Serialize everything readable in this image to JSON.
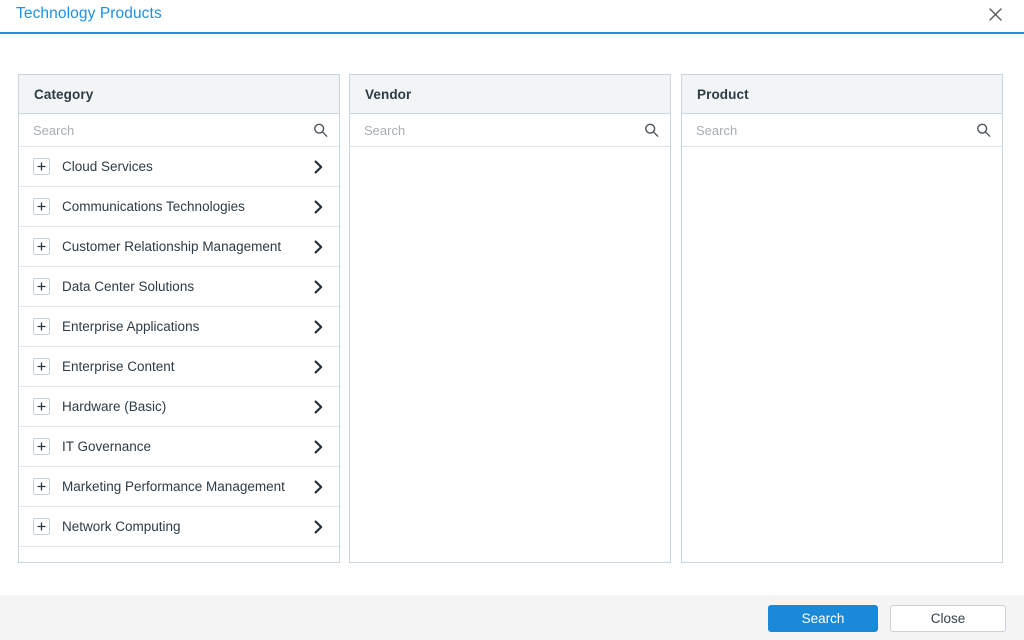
{
  "header": {
    "title": "Technology Products",
    "close_icon": "close-x-icon"
  },
  "panels": [
    {
      "key": "category",
      "title": "Category",
      "search_placeholder": "Search",
      "search_value": "",
      "search_icon": "magnifier-icon",
      "items": [
        {
          "expand_icon": "plus-icon",
          "label": "Cloud Services",
          "chevron_icon": "chevron-right-icon"
        },
        {
          "expand_icon": "plus-icon",
          "label": "Communications Technologies",
          "chevron_icon": "chevron-right-icon"
        },
        {
          "expand_icon": "plus-icon",
          "label": "Customer Relationship Management",
          "chevron_icon": "chevron-right-icon"
        },
        {
          "expand_icon": "plus-icon",
          "label": "Data Center Solutions",
          "chevron_icon": "chevron-right-icon"
        },
        {
          "expand_icon": "plus-icon",
          "label": "Enterprise Applications",
          "chevron_icon": "chevron-right-icon"
        },
        {
          "expand_icon": "plus-icon",
          "label": "Enterprise Content",
          "chevron_icon": "chevron-right-icon"
        },
        {
          "expand_icon": "plus-icon",
          "label": "Hardware (Basic)",
          "chevron_icon": "chevron-right-icon"
        },
        {
          "expand_icon": "plus-icon",
          "label": "IT Governance",
          "chevron_icon": "chevron-right-icon"
        },
        {
          "expand_icon": "plus-icon",
          "label": "Marketing Performance Management",
          "chevron_icon": "chevron-right-icon"
        },
        {
          "expand_icon": "plus-icon",
          "label": "Network Computing",
          "chevron_icon": "chevron-right-icon"
        },
        {
          "expand_icon": "plus-icon",
          "label": "",
          "chevron_icon": "chevron-right-icon"
        }
      ]
    },
    {
      "key": "vendor",
      "title": "Vendor",
      "search_placeholder": "Search",
      "search_value": "",
      "search_icon": "magnifier-icon",
      "items": []
    },
    {
      "key": "product",
      "title": "Product",
      "search_placeholder": "Search",
      "search_value": "",
      "search_icon": "magnifier-icon",
      "items": []
    }
  ],
  "footer": {
    "search_label": "Search",
    "close_label": "Close"
  },
  "colors": {
    "accent_blue": "#1a8ad8",
    "title_blue": "#2090e4",
    "panel_header_bg": "#f2f4f5",
    "panel_border": "#c9d6de",
    "row_border": "#dde5ea",
    "footer_bg": "#f4f4f5",
    "text_dark": "#2e3b45",
    "placeholder_gray": "#a8adb2"
  }
}
